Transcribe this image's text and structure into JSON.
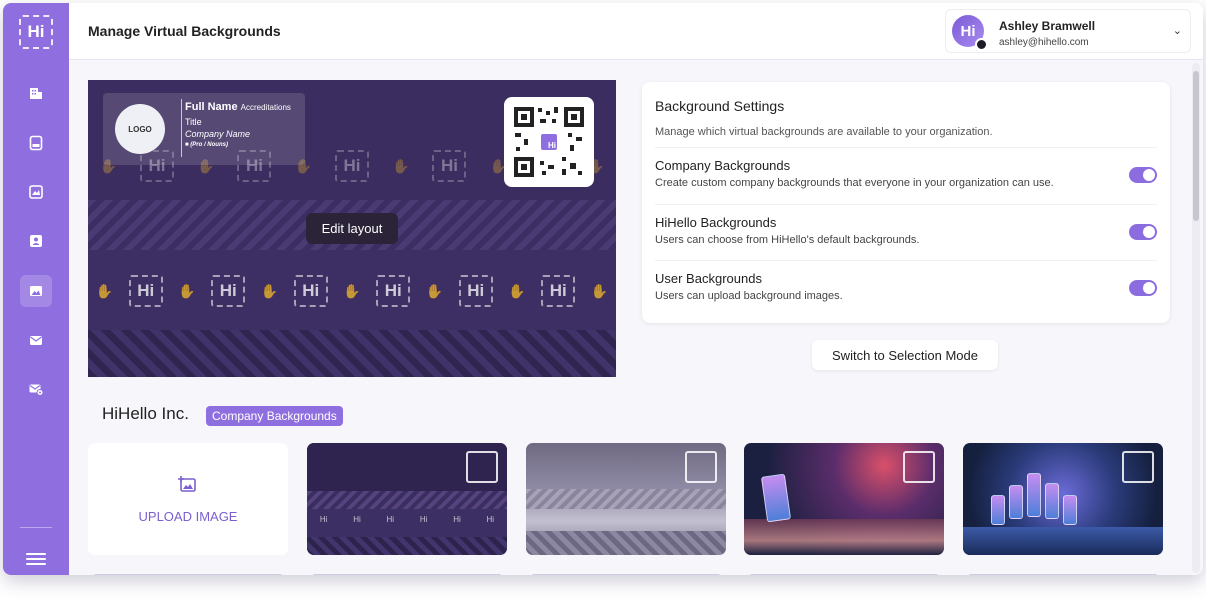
{
  "header": {
    "title": "Manage Virtual Backgrounds"
  },
  "user": {
    "initials": "Hi",
    "name": "Ashley Bramwell",
    "email": "ashley@hihello.com"
  },
  "sidebar": {
    "logo": "Hi",
    "items": [
      {
        "icon": "building-icon"
      },
      {
        "icon": "card-icon"
      },
      {
        "icon": "gallery-icon"
      },
      {
        "icon": "contact-icon"
      },
      {
        "icon": "image-icon",
        "active": true
      },
      {
        "icon": "mail-icon"
      },
      {
        "icon": "mail-settings-icon"
      }
    ]
  },
  "preview": {
    "signature": {
      "logo": "LOGO",
      "name": "Full Name",
      "accreditations": "Accreditations",
      "title": "Title",
      "company": "Company Name",
      "pronouns": "(Pro / Nouns)"
    },
    "qr_label": "Hi",
    "tile_label": "Hi",
    "edit_button": "Edit layout"
  },
  "settings": {
    "title": "Background Settings",
    "description": "Manage which virtual backgrounds are available to your organization.",
    "rows": [
      {
        "title": "Company Backgrounds",
        "description": "Create custom company backgrounds that everyone in your organization can use.",
        "enabled": true
      },
      {
        "title": "HiHello Backgrounds",
        "description": "Users can choose from HiHello's default backgrounds.",
        "enabled": true
      },
      {
        "title": "User Backgrounds",
        "description": "Users can upload background images.",
        "enabled": true
      }
    ],
    "switch_button": "Switch to Selection Mode"
  },
  "gallery": {
    "org_name": "HiHello Inc.",
    "badge": "Company Backgrounds",
    "upload_label": "UPLOAD IMAGE",
    "mini_label": "Hi"
  },
  "colors": {
    "accent": "#8f6fe0",
    "sidebar": "#8f6fe0",
    "text": "#222222"
  }
}
